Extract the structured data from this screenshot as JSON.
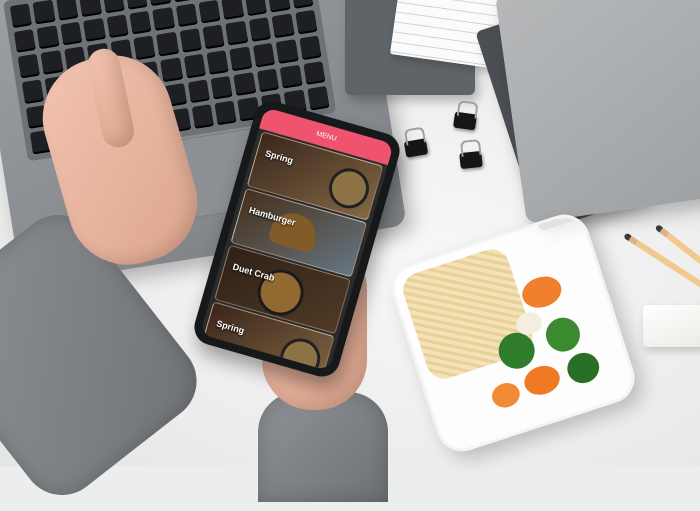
{
  "scene": "Hands using food-delivery app on smartphone beside laptop and lunch box",
  "phone_app": {
    "header": "MENU",
    "cards": [
      {
        "title": "Spring",
        "subtitle": ""
      },
      {
        "title": "Hamburger",
        "subtitle": ""
      },
      {
        "title": "Duet Crab",
        "subtitle": ""
      },
      {
        "title": "Spring",
        "subtitle": ""
      }
    ]
  },
  "colors": {
    "accent": "#f0536e",
    "desk": "#ececec",
    "laptop": "#8e9297"
  }
}
